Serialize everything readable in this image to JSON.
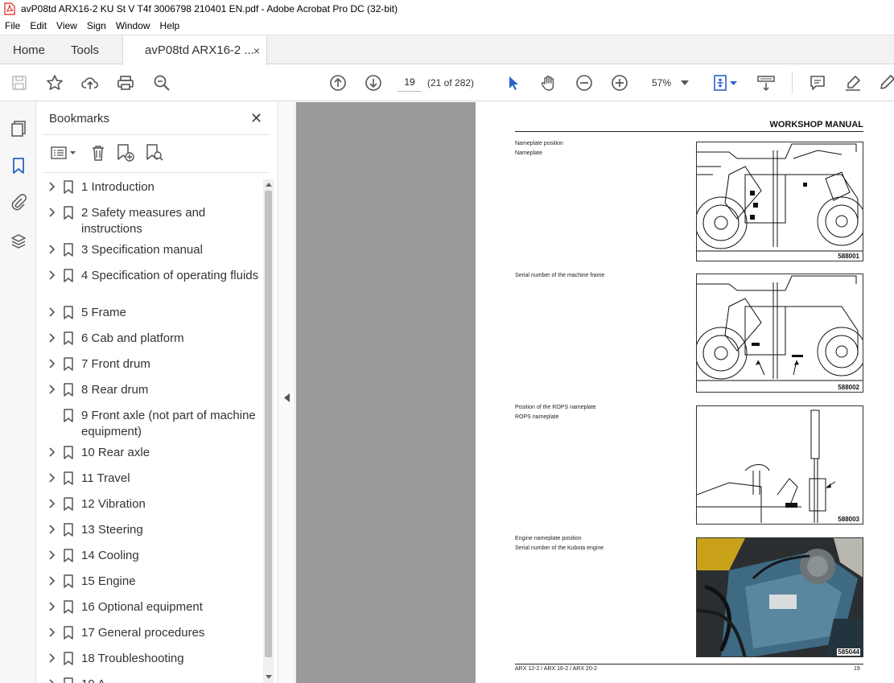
{
  "window": {
    "title": "avP08td ARX16-2 KU St V T4f 3006798 210401 EN.pdf - Adobe Acrobat Pro DC (32-bit)"
  },
  "menu": [
    "File",
    "Edit",
    "View",
    "Sign",
    "Window",
    "Help"
  ],
  "tabs": {
    "home": "Home",
    "tools": "Tools",
    "document": "avP08td ARX16-2 ...",
    "close_glyph": "×"
  },
  "toolbar": {
    "page_number": "19",
    "page_count": "(21 of 282)",
    "zoom": "57%"
  },
  "bookmarks": {
    "title": "Bookmarks",
    "close_glyph": "✕",
    "items": [
      {
        "label": "1 Introduction",
        "has_children": true
      },
      {
        "label": "2 Safety measures and instructions",
        "has_children": true
      },
      {
        "label": "3 Specification manual",
        "has_children": true
      },
      {
        "label": "4 Specification of operating fluids",
        "has_children": true
      },
      {
        "label": "5 Frame",
        "has_children": true
      },
      {
        "label": "6 Cab and platform",
        "has_children": true
      },
      {
        "label": "7 Front drum",
        "has_children": true
      },
      {
        "label": "8 Rear drum",
        "has_children": true
      },
      {
        "label": "9 Front axle (not part of machine equipment)",
        "has_children": false
      },
      {
        "label": "10 Rear axle",
        "has_children": true
      },
      {
        "label": "11 Travel",
        "has_children": true
      },
      {
        "label": "12 Vibration",
        "has_children": true
      },
      {
        "label": "13 Steering",
        "has_children": true
      },
      {
        "label": "14 Cooling",
        "has_children": true
      },
      {
        "label": "15 Engine",
        "has_children": true
      },
      {
        "label": "16 Optional equipment",
        "has_children": true
      },
      {
        "label": "17 General procedures",
        "has_children": true
      },
      {
        "label": "18 Troubleshooting",
        "has_children": true
      },
      {
        "label": "19 A...",
        "has_children": true
      }
    ]
  },
  "document": {
    "header": "WORKSHOP MANUAL",
    "sections": [
      {
        "lines": [
          "Nameplate position",
          "Nameplate"
        ],
        "figure_number": "588001"
      },
      {
        "lines": [
          "Serial number of the machine frame"
        ],
        "figure_number": "588002"
      },
      {
        "lines": [
          "Position of the ROPS nameplate",
          "ROPS nameplate"
        ],
        "figure_number": "588003"
      },
      {
        "lines": [
          "Engine nameplate position",
          "Serial number of the Kubota engine"
        ],
        "figure_number": "585044"
      }
    ],
    "footer_models": "ARX 12-2 / ARX 16-2 / ARX 20-2",
    "footer_page": "19"
  },
  "colors": {
    "accent_blue": "#2a62c9",
    "pdf_red": "#e02020",
    "document_bg": "#9a9a9a"
  }
}
